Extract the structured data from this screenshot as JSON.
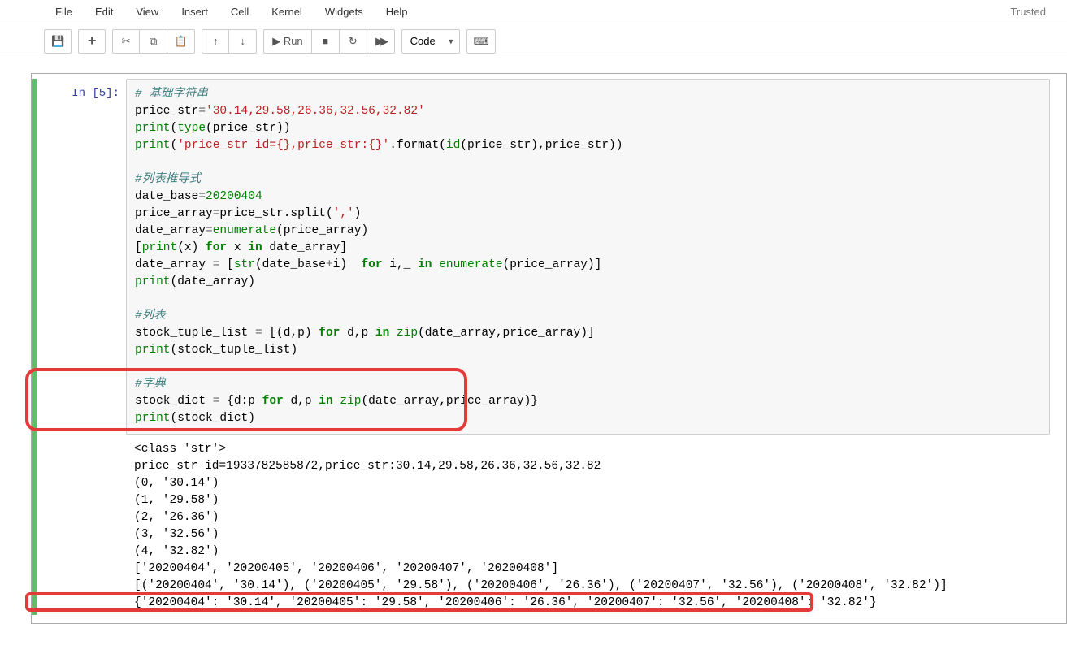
{
  "menubar": {
    "items": [
      "File",
      "Edit",
      "View",
      "Insert",
      "Cell",
      "Kernel",
      "Widgets",
      "Help"
    ],
    "trusted": "Trusted"
  },
  "toolbar": {
    "save_icon": "💾",
    "add_icon": "+",
    "cut_icon": "✂",
    "copy_icon": "⧉",
    "paste_icon": "📋",
    "up_icon": "↑",
    "down_icon": "↓",
    "run_icon": "▶",
    "run_label": "Run",
    "stop_icon": "■",
    "restart_icon": "↻",
    "ff_icon": "▶▶",
    "celltype": "Code",
    "keyboard_icon": "⌨"
  },
  "cell": {
    "prompt_prefix": "In  [",
    "prompt_num": "5",
    "prompt_suffix": "]:",
    "code": {
      "l1_comment": "# 基础字符串",
      "l2a": "price_str",
      "l2b": "=",
      "l2c": "'30.14,29.58,26.36,32.56,32.82'",
      "l3a": "print",
      "l3b": "(",
      "l3c": "type",
      "l3d": "(price_str))",
      "l4a": "print",
      "l4b": "(",
      "l4c": "'price_str id={},price_str:{}'",
      "l4d": ".format(",
      "l4e": "id",
      "l4f": "(price_str),price_str))",
      "l5_comment": "#列表推导式",
      "l6a": "date_base",
      "l6b": "=",
      "l6c": "20200404",
      "l7a": "price_array",
      "l7b": "=",
      "l7c": "price_str.split(",
      "l7d": "','",
      "l7e": ")",
      "l8a": "date_array",
      "l8b": "=",
      "l8c": "enumerate",
      "l8d": "(price_array)",
      "l9a": "[",
      "l9b": "print",
      "l9c": "(x) ",
      "l9d": "for",
      "l9e": " x ",
      "l9f": "in",
      "l9g": " date_array]",
      "l10a": "date_array ",
      "l10b": "=",
      "l10c": " [",
      "l10d": "str",
      "l10e": "(date_base",
      "l10f": "+",
      "l10g": "i)  ",
      "l10h": "for",
      "l10i": " i,_ ",
      "l10j": "in",
      "l10k": " ",
      "l10l": "enumerate",
      "l10m": "(price_array)]",
      "l11a": "print",
      "l11b": "(date_array)",
      "l12_comment": "#列表",
      "l13a": "stock_tuple_list ",
      "l13b": "=",
      "l13c": " [(d,p) ",
      "l13d": "for",
      "l13e": " d,p ",
      "l13f": "in",
      "l13g": " ",
      "l13h": "zip",
      "l13i": "(date_array,price_array)]",
      "l14a": "print",
      "l14b": "(stock_tuple_list)",
      "l15_comment": "#字典",
      "l16a": "stock_dict ",
      "l16b": "=",
      "l16c": " {d:p ",
      "l16d": "for",
      "l16e": " d,p ",
      "l16f": "in",
      "l16g": " ",
      "l16h": "zip",
      "l16i": "(date_array,price_array)}",
      "l17a": "print",
      "l17b": "(stock_dict)"
    },
    "output": {
      "o1": "<class 'str'>",
      "o2": "price_str id=1933782585872,price_str:30.14,29.58,26.36,32.56,32.82",
      "o3": "(0, '30.14')",
      "o4": "(1, '29.58')",
      "o5": "(2, '26.36')",
      "o6": "(3, '32.56')",
      "o7": "(4, '32.82')",
      "o8": "['20200404', '20200405', '20200406', '20200407', '20200408']",
      "o9": "[('20200404', '30.14'), ('20200405', '29.58'), ('20200406', '26.36'), ('20200407', '32.56'), ('20200408', '32.82')]",
      "o10": "{'20200404': '30.14', '20200405': '29.58', '20200406': '26.36', '20200407': '32.56', '20200408': '32.82'}"
    }
  }
}
